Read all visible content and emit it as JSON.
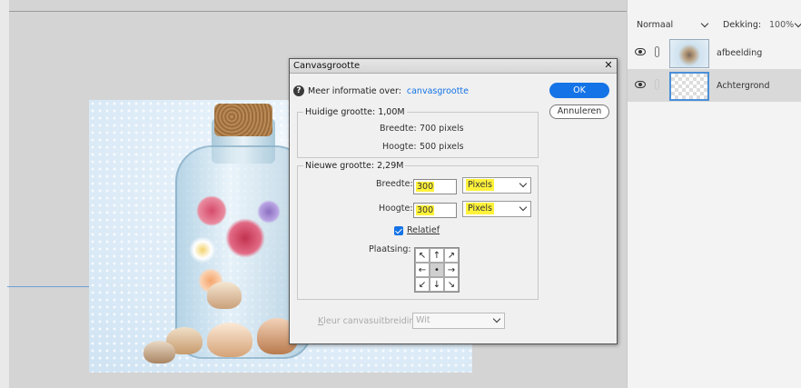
{
  "dialog": {
    "title": "Canvasgrootte",
    "info_text": "Meer informatie over:",
    "info_link": "canvasgrootte",
    "ok_label": "OK",
    "cancel_label": "Annuleren",
    "current": {
      "title": "Huidige grootte: 1,00M",
      "width_label": "Breedte:",
      "width_value": "700 pixels",
      "height_label": "Hoogte:",
      "height_value": "500 pixels"
    },
    "new": {
      "title": "Nieuwe grootte: 2,29M",
      "width_label": "Breedte:",
      "width_value": "300",
      "width_unit": "Pixels",
      "height_label": "Hoogte:",
      "height_value": "300",
      "height_unit": "Pixels",
      "relative_label": "Relatief",
      "relative_checked": true,
      "anchor_label": "Plaatsing:",
      "anchor_arrows": [
        "↖",
        "↑",
        "↗",
        "←",
        "•",
        "→",
        "↙",
        "↓",
        "↘"
      ]
    },
    "extension_label_underlined": "K",
    "extension_label_rest": "leur canvasuitbreiding:",
    "extension_value": "Wit"
  },
  "layers_panel": {
    "blend_mode": "Normaal",
    "opacity_label": "Dekking:",
    "opacity_value": "100%",
    "layers": [
      {
        "name": "afbeelding",
        "visible": true
      },
      {
        "name": "Achtergrond",
        "visible": true,
        "selected": true
      }
    ]
  },
  "colors": {
    "accent": "#1473e6",
    "highlight": "#fff23a",
    "workspace": "#d4d4d4",
    "panel": "#f3f3f3"
  }
}
